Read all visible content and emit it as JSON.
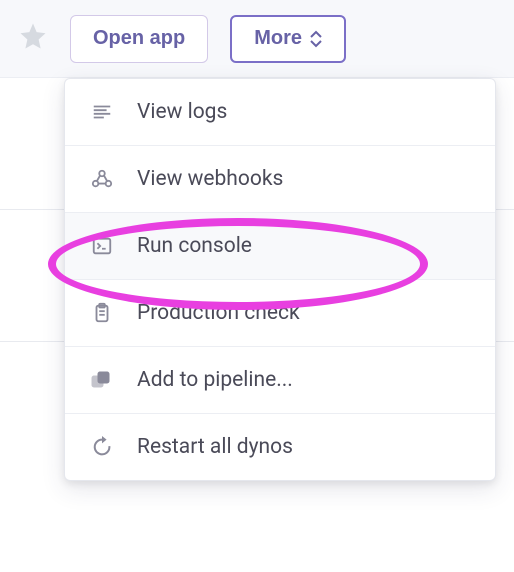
{
  "toolbar": {
    "open_app_label": "Open app",
    "more_label": "More"
  },
  "menu": {
    "items": [
      {
        "label": "View logs"
      },
      {
        "label": "View webhooks"
      },
      {
        "label": "Run console"
      },
      {
        "label": "Production check"
      },
      {
        "label": "Add to pipeline..."
      },
      {
        "label": "Restart all dynos"
      }
    ]
  }
}
